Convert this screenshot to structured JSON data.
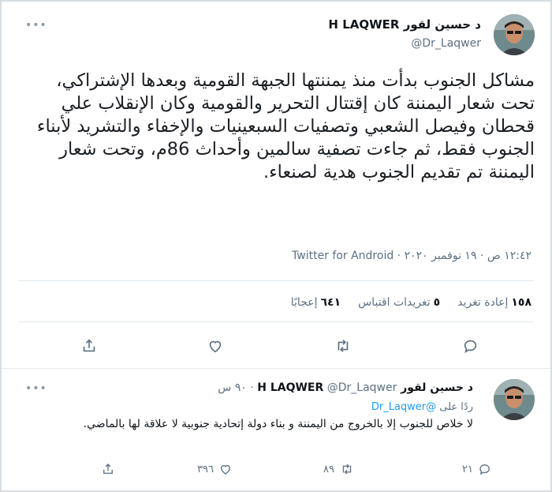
{
  "tweet": {
    "author_name": "د حسين لقور H LAQWER",
    "author_handle": "@Dr_Laqwer",
    "more_label": "•••",
    "text": "مشاكل الجنوب بدأت منذ يمننتها الجبهة القومية وبعدها الإشتراكي، تحت شعار اليمننة كان إقتتال التحرير والقومية وكان الإنقلاب علي قحطان وفيصل الشعبي وتصفيات السبعينيات والإخفاء والتشريد لأبناء الجنوب فقط، ثم جاءت تصفية سالمين وأحداث 86م، وتحت شعار اليمننة تم تقديم الجنوب هدية لصنعاء.",
    "timestamp": "١٢:٤٢ ص · ١٩ نوفمبر ٢٠٢٠ · Twitter for Android",
    "stats": {
      "retweets_count": "١٥٨",
      "retweets_label": "إعادة تغريد",
      "quotes_count": "٥",
      "quotes_label": "تغريدات اقتباس",
      "likes_count": "٦٤١",
      "likes_label": "إعجابًا"
    }
  },
  "reply": {
    "author_name": "د حسين لقور H LAQWER",
    "author_handle": "@Dr_Laqwer",
    "time": "· ٩٠ س",
    "replying_prefix": "ردًا على",
    "replying_handle": "@Dr_Laqwer",
    "text": "لا خلاص للجنوب إلا بالخروج من اليمننة و بناء دولة إتحادية جنوبية لا علاقة لها بالماضي.",
    "reply_count": "٢١",
    "retweet_count": "٨٩",
    "like_count": "٣٩٦",
    "more_label": "•••"
  },
  "icons": {
    "reply": "speech-bubble-icon",
    "retweet": "retweet-arrows-icon",
    "like": "heart-icon",
    "share": "share-upload-icon"
  },
  "colors": {
    "link": "#1d9bf0",
    "secondary_text": "#5b7083"
  }
}
